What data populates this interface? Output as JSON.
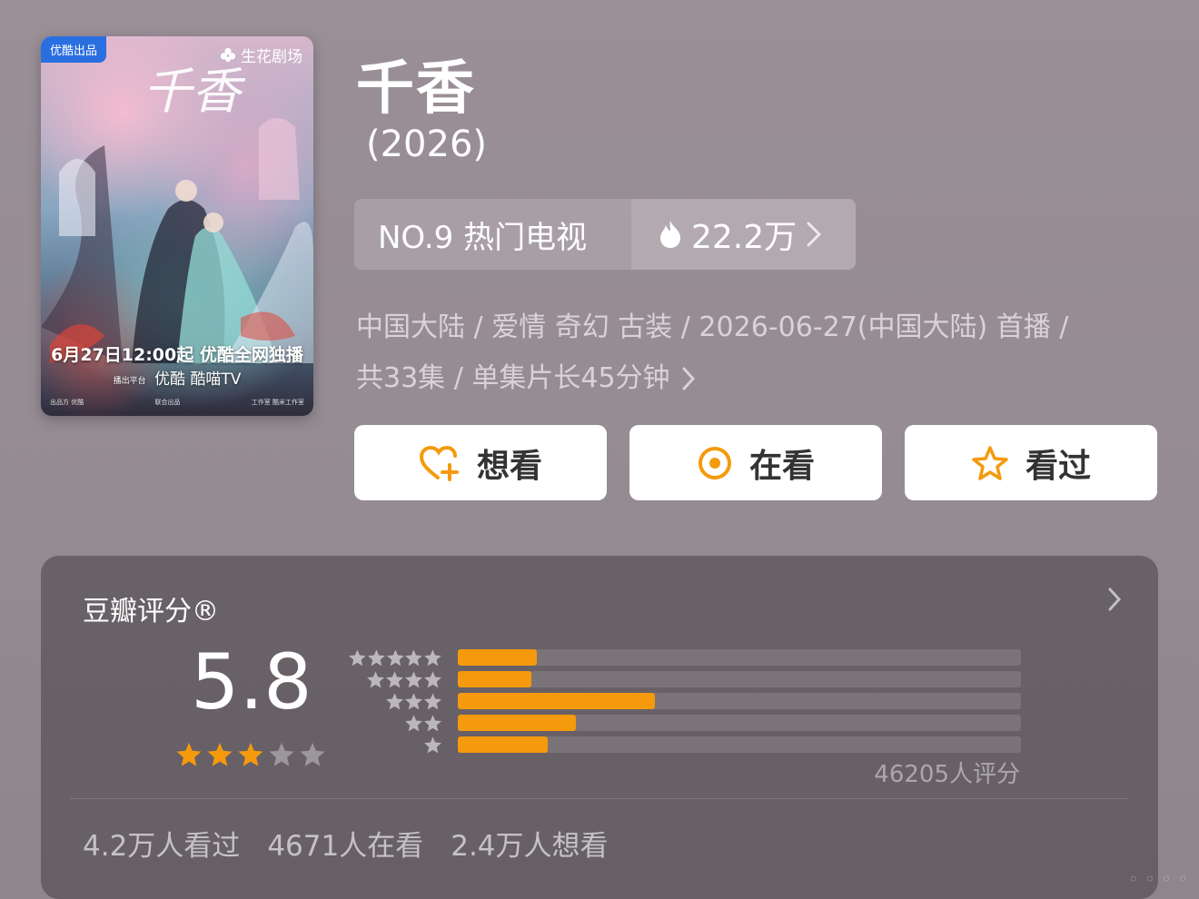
{
  "poster": {
    "badge": "优酷出品",
    "brand": "生花剧场",
    "calligraphy": "千香",
    "date_line": "6月27日12:00起 优酷全网独播",
    "platform_label": "播出平台",
    "platform_1": "优酷",
    "platform_2": "酷喵TV",
    "fine_left": "出品方 优酷",
    "fine_mid": "联合出品",
    "fine_right": "工作室 酷米工作室"
  },
  "title": "千香",
  "year": "(2026)",
  "rank": {
    "label": "NO.9 热门电视",
    "heat": "22.2万"
  },
  "meta": {
    "line1": "中国大陆 / 爱情 奇幻 古装 / 2026-06-27(中国大陆) 首播 /",
    "line2": "共33集 / 单集片长45分钟"
  },
  "actions": [
    {
      "label": "想看",
      "icon": "heart-plus-icon"
    },
    {
      "label": "在看",
      "icon": "target-icon"
    },
    {
      "label": "看过",
      "icon": "star-outline-icon"
    }
  ],
  "rating": {
    "title": "豆瓣评分®",
    "score": "5.8",
    "stars_filled": 3,
    "stars_total": 5,
    "distribution": [
      {
        "stars": 5,
        "fraction": 0.14
      },
      {
        "stars": 4,
        "fraction": 0.13
      },
      {
        "stars": 3,
        "fraction": 0.35
      },
      {
        "stars": 2,
        "fraction": 0.21
      },
      {
        "stars": 1,
        "fraction": 0.16
      }
    ],
    "count": "46205人评分",
    "watched": "4.2万人看过",
    "watching": "4671人在看",
    "want": "2.4万人想看"
  },
  "colors": {
    "accent": "#f59a0c",
    "star_on": "#f59a0c",
    "star_off": "rgba(255,255,255,0.35)"
  }
}
